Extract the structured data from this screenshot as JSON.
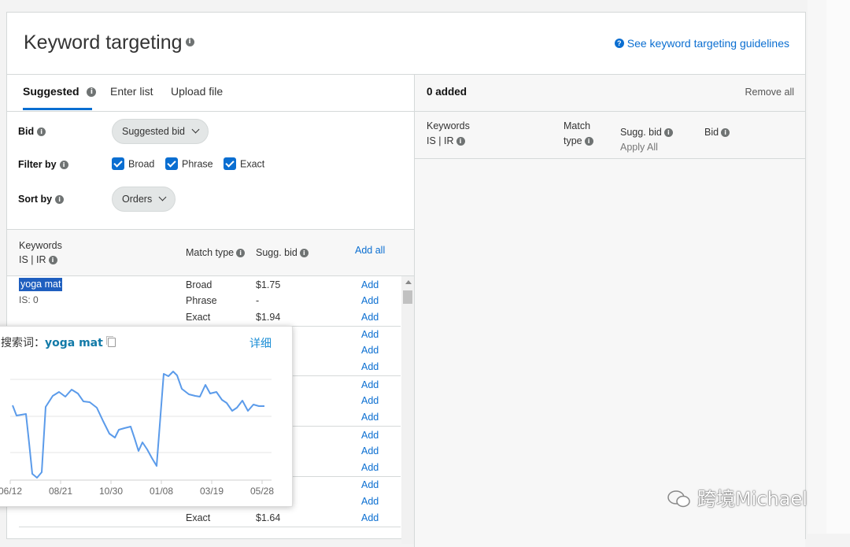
{
  "header": {
    "title": "Keyword targeting",
    "guidelines_link": "See keyword targeting guidelines"
  },
  "tabs": [
    {
      "label": "Suggested",
      "active": true
    },
    {
      "label": "Enter list",
      "active": false
    },
    {
      "label": "Upload file",
      "active": false
    }
  ],
  "controls": {
    "bid_label": "Bid",
    "bid_value": "Suggested bid",
    "filter_label": "Filter by",
    "filters": [
      {
        "label": "Broad",
        "checked": true
      },
      {
        "label": "Phrase",
        "checked": true
      },
      {
        "label": "Exact",
        "checked": true
      }
    ],
    "sort_label": "Sort by",
    "sort_value": "Orders"
  },
  "list_header": {
    "keywords": "Keywords",
    "is_ir": "IS | IR",
    "match_type": "Match type",
    "sugg_bid": "Sugg. bid",
    "add_all": "Add all"
  },
  "rows": [
    {
      "keyword": "yoga mat",
      "is": "IS: 0",
      "match": "Broad",
      "bid": "$1.75",
      "add": "Add"
    },
    {
      "match": "Phrase",
      "bid": "-",
      "add": "Add"
    },
    {
      "match": "Exact",
      "bid": "$1.94",
      "add": "Add"
    },
    {
      "add": "Add"
    },
    {
      "add": "Add"
    },
    {
      "add": "Add"
    },
    {
      "add": "Add"
    },
    {
      "add": "Add"
    },
    {
      "add": "Add"
    },
    {
      "add": "Add"
    },
    {
      "add": "Add"
    },
    {
      "add": "Add"
    },
    {
      "add": "Add"
    },
    {
      "add": "Add"
    },
    {
      "match": "Exact",
      "bid": "$1.64",
      "add": "Add"
    }
  ],
  "right_panel": {
    "added_count": "0 added",
    "remove_all": "Remove all",
    "col_keywords": "Keywords",
    "col_is_ir": "IS | IR",
    "col_match_1": "Match",
    "col_match_2": "type",
    "col_sugg_bid": "Sugg. bid",
    "col_apply_all": "Apply All",
    "col_bid": "Bid"
  },
  "popup": {
    "label": "搜索词：",
    "keyword": "yoga mat",
    "detail_link": "详细",
    "x_labels": [
      "06/12",
      "08/21",
      "10/30",
      "01/08",
      "03/19",
      "05/28"
    ],
    "line_color": "#5b9bea"
  },
  "watermark": "跨境Michael"
}
